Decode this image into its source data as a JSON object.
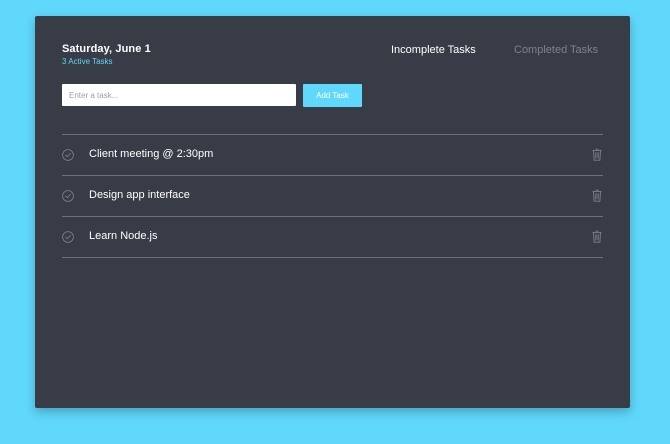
{
  "header": {
    "date": "Saturday, June 1",
    "active_count": "3 Active Tasks"
  },
  "tabs": {
    "incomplete": "Incomplete Tasks",
    "completed": "Completed Tasks"
  },
  "form": {
    "placeholder": "Enter a task...",
    "value": "",
    "add_label": "Add Task"
  },
  "tasks": [
    {
      "text": "Client meeting @ 2:30pm"
    },
    {
      "text": "Design app interface"
    },
    {
      "text": "Learn Node.js"
    }
  ],
  "icons": {
    "check": "check-circle-icon",
    "delete": "trash-icon"
  },
  "colors": {
    "background": "#5fd8fb",
    "card": "#383c46",
    "accent": "#5fd8fb",
    "muted": "#7d828c"
  }
}
